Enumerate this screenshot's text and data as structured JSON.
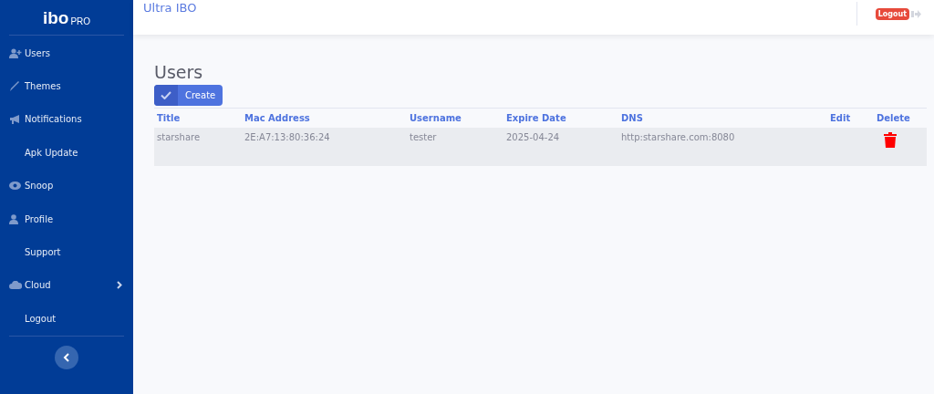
{
  "logo": {
    "main": "ibo",
    "sub": "PRO"
  },
  "sidebar": {
    "items": [
      {
        "label": "Users",
        "kind": "users",
        "expandable": false
      },
      {
        "label": "Themes",
        "kind": "themes",
        "expandable": false
      },
      {
        "label": "Notifications",
        "kind": "notifications",
        "expandable": false
      },
      {
        "label": "Apk Update",
        "kind": "plain",
        "expandable": false
      },
      {
        "label": "Snoop",
        "kind": "snoop",
        "expandable": false
      },
      {
        "label": "Profile",
        "kind": "profile",
        "expandable": false
      },
      {
        "label": "Support",
        "kind": "plain",
        "expandable": false
      },
      {
        "label": "Cloud",
        "kind": "cloud",
        "expandable": true
      },
      {
        "label": "Logout",
        "kind": "plain",
        "expandable": false
      }
    ]
  },
  "topbar": {
    "title": "Ultra IBO",
    "logout": "Logout"
  },
  "page": {
    "heading": "Users",
    "create_button": "Create"
  },
  "table": {
    "columns": [
      "Title",
      "Mac Address",
      "Username",
      "Expire Date",
      "DNS",
      "Edit",
      "Delete"
    ],
    "rows": [
      {
        "cells": [
          "starshare",
          "2E:A7:13:80:36:24",
          "tester",
          "2025-04-24",
          "http:starshare.com:8080"
        ],
        "deletable": true
      }
    ]
  }
}
